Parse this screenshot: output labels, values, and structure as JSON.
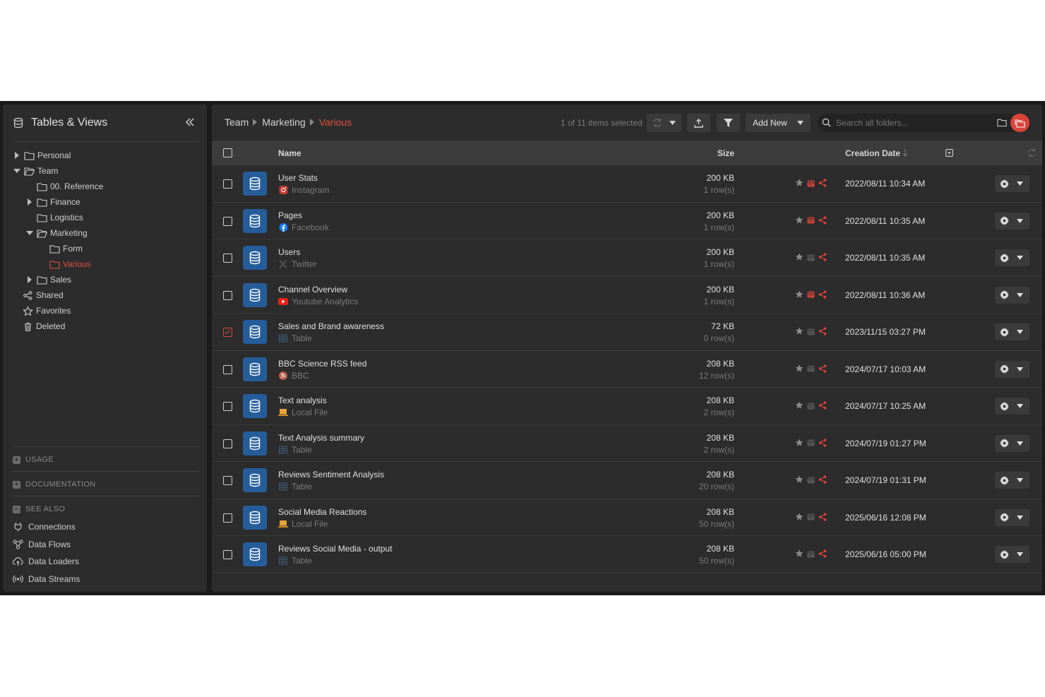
{
  "sidebar": {
    "title": "Tables & Views",
    "tree": [
      {
        "label": "Personal"
      },
      {
        "label": "Team"
      },
      {
        "label": "00. Reference"
      },
      {
        "label": "Finance"
      },
      {
        "label": "Logistics"
      },
      {
        "label": "Marketing"
      },
      {
        "label": "Form"
      },
      {
        "label": "Various"
      },
      {
        "label": "Sales"
      },
      {
        "label": "Shared"
      },
      {
        "label": "Favorites"
      },
      {
        "label": "Deleted"
      }
    ],
    "sections": {
      "usage": "USAGE",
      "documentation": "DOCUMENTATION",
      "see_also": "SEE ALSO"
    },
    "see_also_items": [
      {
        "label": "Connections"
      },
      {
        "label": "Data Flows"
      },
      {
        "label": "Data Loaders"
      },
      {
        "label": "Data Streams"
      }
    ]
  },
  "breadcrumb": [
    "Team",
    "Marketing",
    "Various"
  ],
  "toolbar": {
    "selection": "1 of 11 items selected",
    "add_new": "Add New",
    "search_placeholder": "Search all folders..."
  },
  "table": {
    "columns": {
      "name": "Name",
      "size": "Size",
      "date": "Creation Date"
    },
    "rows": [
      {
        "name": "User Stats",
        "source": "Instagram",
        "size": "200 KB",
        "rows": "1 row(s)",
        "date": "2022/08/11 10:34 AM",
        "checked": false
      },
      {
        "name": "Pages",
        "source": "Facebook",
        "size": "200 KB",
        "rows": "1 row(s)",
        "date": "2022/08/11 10:35 AM",
        "checked": false
      },
      {
        "name": "Users",
        "source": "Twitter",
        "size": "200 KB",
        "rows": "1 row(s)",
        "date": "2022/08/11 10:35 AM",
        "checked": false
      },
      {
        "name": "Channel Overview",
        "source": "Youtube Analytics",
        "size": "200 KB",
        "rows": "1 row(s)",
        "date": "2022/08/11 10:36 AM",
        "checked": false
      },
      {
        "name": "Sales and Brand awareness",
        "source": "Table",
        "size": "72 KB",
        "rows": "0 row(s)",
        "date": "2023/11/15 03:27 PM",
        "checked": true
      },
      {
        "name": "BBC Science RSS feed",
        "source": "BBC",
        "size": "208 KB",
        "rows": "12 row(s)",
        "date": "2024/07/17 10:03 AM",
        "checked": false
      },
      {
        "name": "Text analysis",
        "source": "Local File",
        "size": "208 KB",
        "rows": "2 row(s)",
        "date": "2024/07/17 10:25 AM",
        "checked": false
      },
      {
        "name": "Text Analysis summary",
        "source": "Table",
        "size": "208 KB",
        "rows": "2 row(s)",
        "date": "2024/07/19 01:27 PM",
        "checked": false
      },
      {
        "name": "Reviews Sentiment Analysis",
        "source": "Table",
        "size": "208 KB",
        "rows": "20 row(s)",
        "date": "2024/07/19 01:31 PM",
        "checked": false
      },
      {
        "name": "Social Media Reactions",
        "source": "Local File",
        "size": "208 KB",
        "rows": "50 row(s)",
        "date": "2025/06/16 12:08 PM",
        "checked": false
      },
      {
        "name": "Reviews Social Media - output",
        "source": "Table",
        "size": "208 KB",
        "rows": "50 row(s)",
        "date": "2025/06/16 05:00 PM",
        "checked": false
      }
    ]
  },
  "colors": {
    "accent": "#d9443a",
    "icon_blue": "#255d9a",
    "panel": "#2c2c2c",
    "header": "#3c3c3c"
  }
}
